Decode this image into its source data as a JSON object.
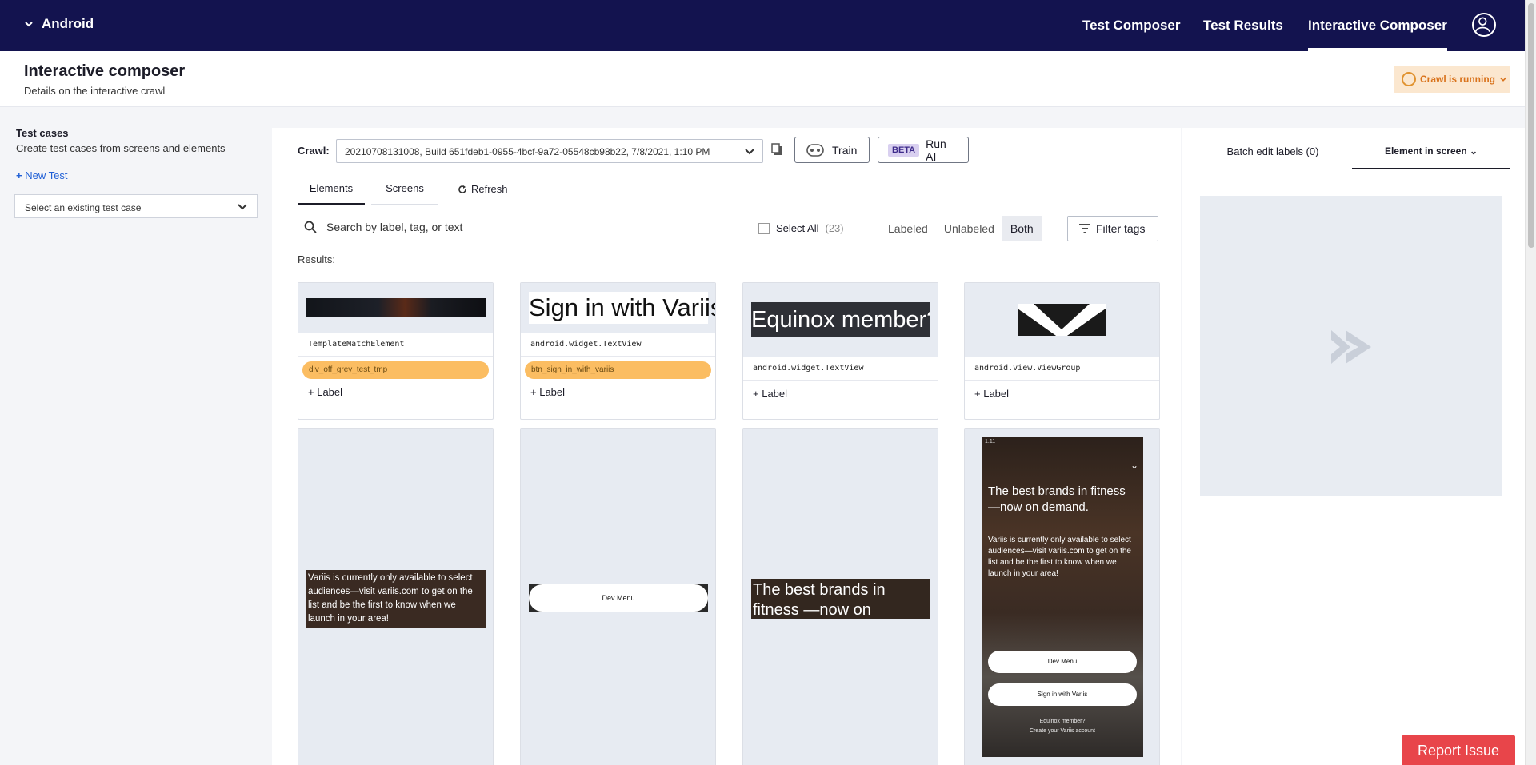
{
  "nav": {
    "app_name": "Android",
    "links": [
      "Test Composer",
      "Test Results",
      "Interactive Composer"
    ],
    "active": "Interactive Composer"
  },
  "header": {
    "title": "Interactive composer",
    "subtitle": "Details on the interactive crawl",
    "crawl_status": "Crawl is running"
  },
  "sidebar": {
    "title": "Test cases",
    "subtitle": "Create test cases from screens and elements",
    "new_test": "New Test",
    "select_placeholder": "Select an existing test case"
  },
  "toolbar": {
    "crawl_label": "Crawl:",
    "crawl_value": "20210708131008, Build 651fdeb1-0955-4bcf-9a72-05548cb98b22, 7/8/2021, 1:10 PM",
    "train_label": "Train",
    "beta_label": "BETA",
    "run_ai_label": "Run AI"
  },
  "tabs": {
    "elements": "Elements",
    "screens": "Screens",
    "refresh": "Refresh"
  },
  "filters": {
    "search_placeholder": "Search by label, tag, or text",
    "select_all": "Select All",
    "count": "(23)",
    "labeled": "Labeled",
    "unlabeled": "Unlabeled",
    "both": "Both",
    "filter_tags": "Filter tags",
    "results_label": "Results:"
  },
  "cards": [
    {
      "tag": "TemplateMatchElement",
      "label": "div_off_grey_test_tmp",
      "add_label": "Label"
    },
    {
      "tag": "android.widget.TextView",
      "label": "btn_sign_in_with_variis",
      "add_label": "Label",
      "image_text": "Sign in with Variis"
    },
    {
      "tag": "android.widget.TextView",
      "add_label": "Label",
      "image_text": "Equinox member?"
    },
    {
      "tag": "android.view.ViewGroup",
      "add_label": "Label"
    },
    {
      "image_text": "Variis is currently only available to select audiences—visit variis.com to get on the list and be the first to know when we launch in your area!"
    },
    {
      "image_text": "Dev Menu"
    },
    {
      "image_text": "The best brands in fitness —now on demand."
    },
    {
      "phone": {
        "time": "1:11",
        "headline": "The best brands in fitness —now on demand.",
        "body": "Variis is currently only available to select audiences—visit variis.com to get on the list and be the first to know when we launch in your area!",
        "btn1": "Dev Menu",
        "btn2": "Sign in with Variis",
        "footer1": "Equinox member?",
        "footer2": "Create your Variis account"
      }
    }
  ],
  "right_panel": {
    "tab1": "Batch edit labels (0)",
    "tab2": "Element in screen"
  },
  "report_issue": "Report Issue",
  "colors": {
    "nav_bg": "#13134f",
    "accent": "#2160d6",
    "label_pill": "#fbbd62",
    "report": "#e8454a",
    "crawl_badge_bg": "#fbe7cf"
  }
}
